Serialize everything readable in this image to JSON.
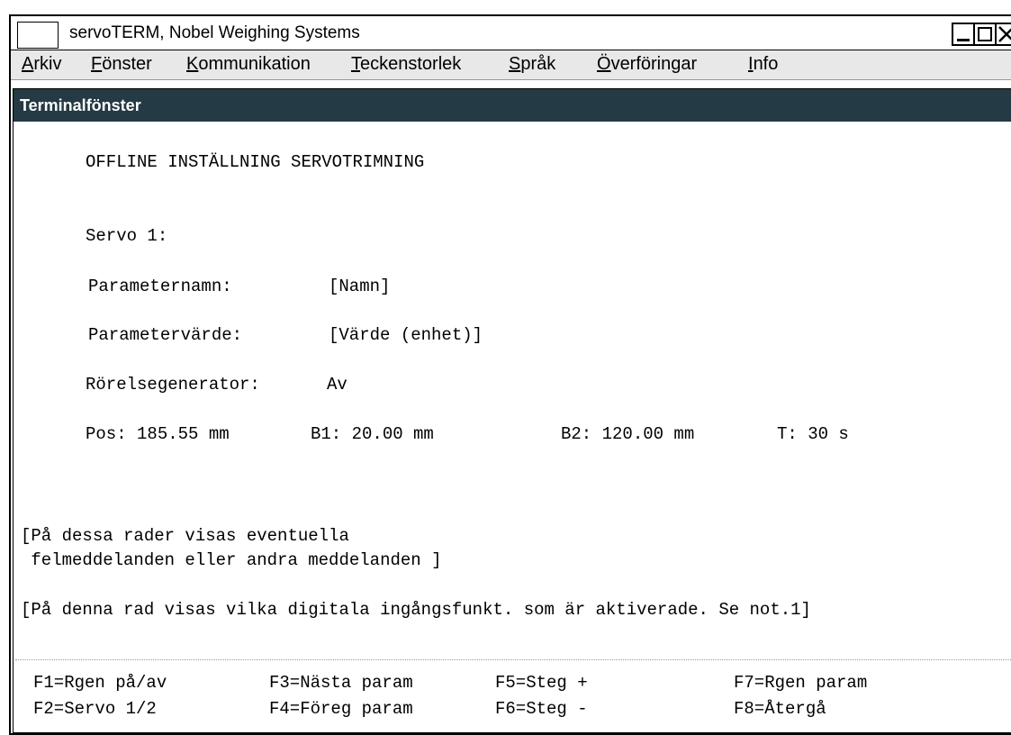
{
  "window": {
    "title": "servoTERM, Nobel Weighing Systems"
  },
  "menu": [
    {
      "underline": "A",
      "rest": "rkiv"
    },
    {
      "underline": "F",
      "rest": "önster"
    },
    {
      "underline": "K",
      "rest": "ommunikation"
    },
    {
      "underline": "T",
      "rest": "eckenstorlek"
    },
    {
      "underline": "S",
      "rest": "pråk"
    },
    {
      "underline": "Ö",
      "rest": "verföringar"
    },
    {
      "underline": "I",
      "rest": "nfo"
    }
  ],
  "terminal": {
    "title": "Terminalfönster",
    "heading": "OFFLINE INSTÄLLNING SERVOTRIMNING",
    "servo": "Servo 1:",
    "param_name_label": "Parameternamn:",
    "param_name_value": "[Namn]",
    "param_value_label": "Parametervärde:",
    "param_value_value": "[Värde (enhet)]",
    "motion_gen_label": "Rörelsegenerator:",
    "motion_gen_value": "Av",
    "pos": "Pos: 185.55 mm",
    "b1": "B1: 20.00 mm",
    "b2": "B2: 120.00 mm",
    "t": "T: 30 s",
    "msg_line1": "[På dessa rader visas eventuella",
    "msg_line2": " felmeddelanden eller andra meddelanden ]",
    "digital_line": "[På denna rad visas vilka digitala ingångsfunkt. som är aktiverade. Se not.1]"
  },
  "fkeys": {
    "f1": "F1=Rgen på/av",
    "f2": "F2=Servo 1/2",
    "f3": "F3=Nästa param",
    "f4": "F4=Föreg param",
    "f5": "F5=Steg +",
    "f6": "F6=Steg -",
    "f7": "F7=Rgen param",
    "f8": "F8=Återgå"
  }
}
